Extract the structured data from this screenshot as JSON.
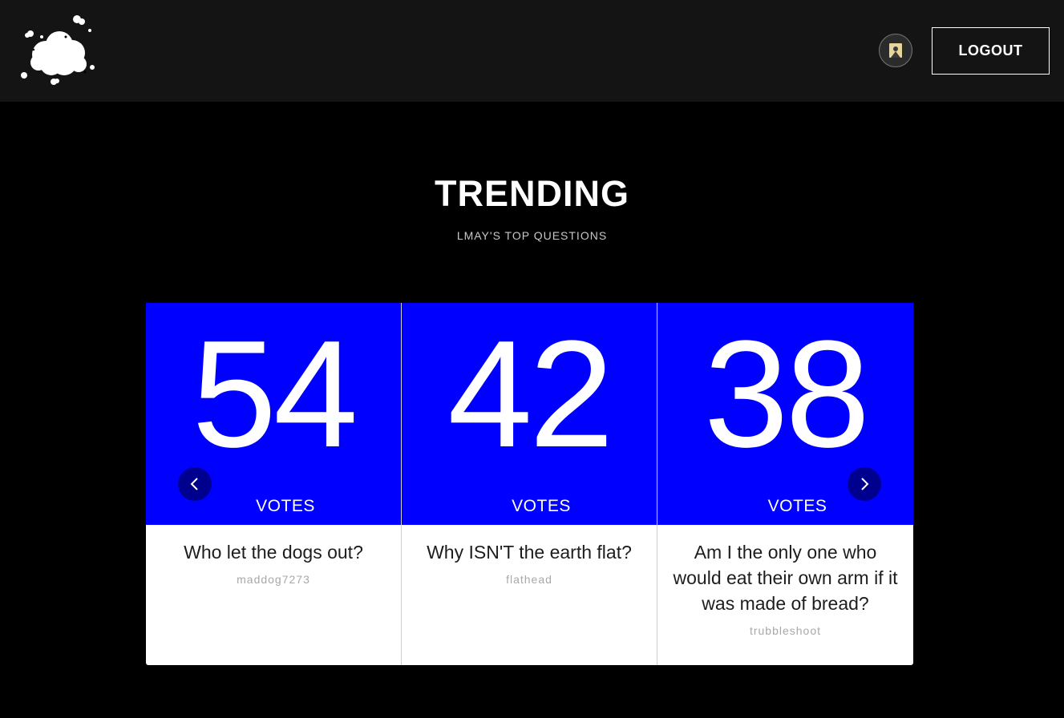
{
  "header": {
    "logo_icon": "cloud-logo-icon",
    "avatar_icon": "user-avatar-icon",
    "logout_label": "LOGOUT"
  },
  "main": {
    "title": "TRENDING",
    "subtitle": "LMAY'S TOP QUESTIONS"
  },
  "carousel": {
    "prev_icon": "chevron-left-icon",
    "next_icon": "chevron-right-icon",
    "accent_color": "#0000ff",
    "arrow_color": "#00008f",
    "cards": [
      {
        "votes": "54",
        "votes_label": "VOTES",
        "question": "Who let the dogs out?",
        "author": "maddog7273"
      },
      {
        "votes": "42",
        "votes_label": "VOTES",
        "question": "Why ISN'T the earth flat?",
        "author": "flathead"
      },
      {
        "votes": "38",
        "votes_label": "VOTES",
        "question": "Am I the only one who would eat their own arm if it was made of bread?",
        "author": "trubbleshoot"
      }
    ]
  }
}
